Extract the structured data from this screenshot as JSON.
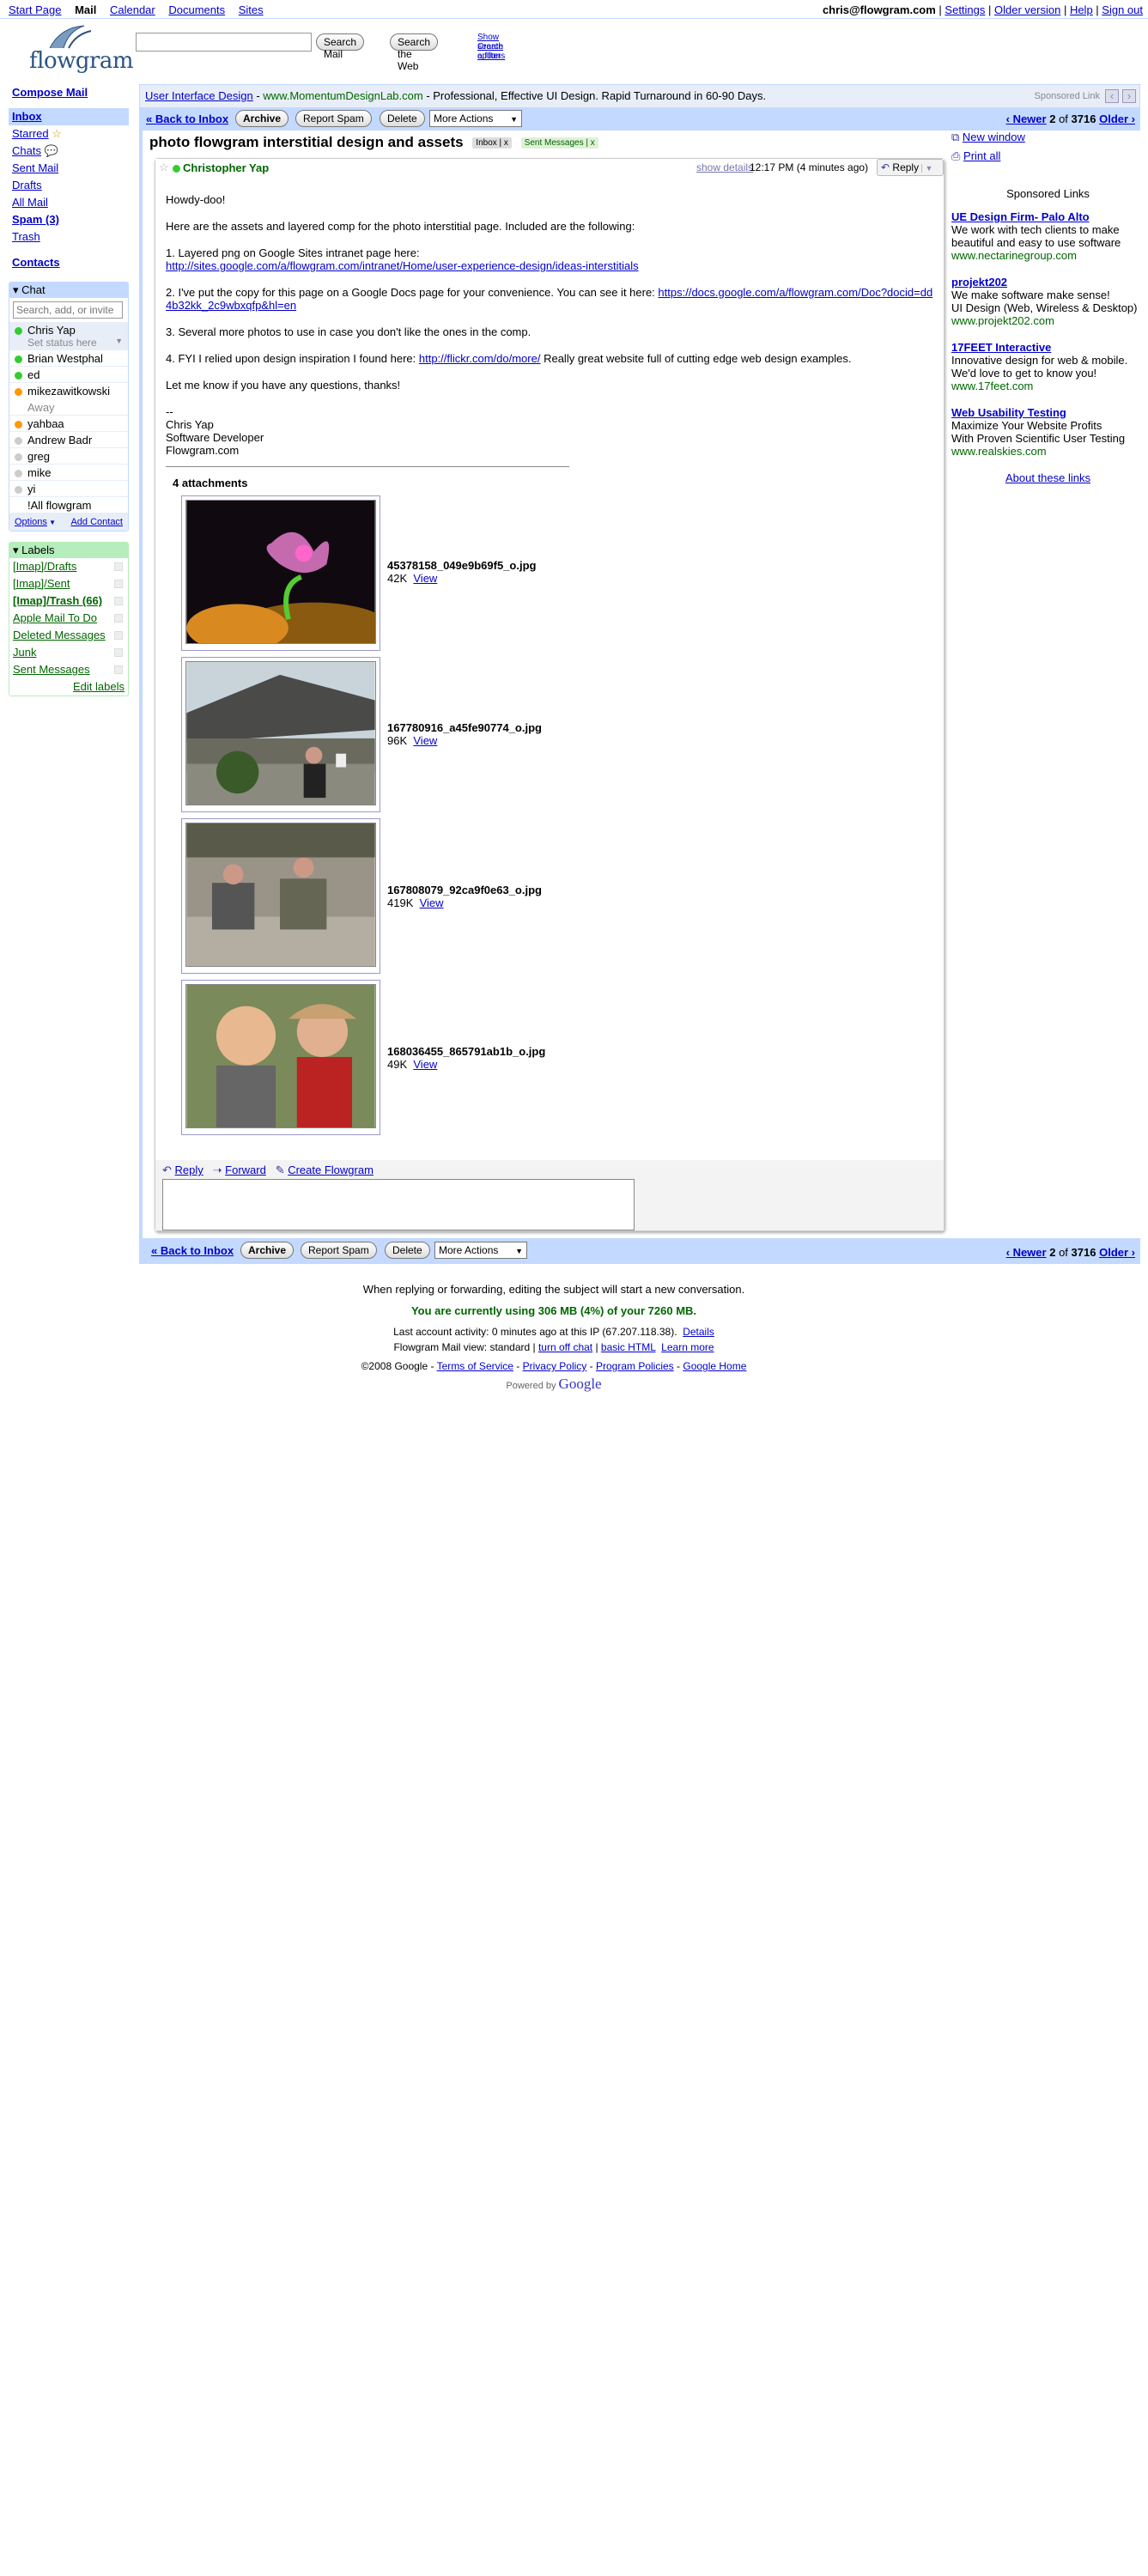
{
  "topnav": {
    "links": [
      "Start Page",
      "Mail",
      "Calendar",
      "Documents",
      "Sites"
    ],
    "user": "chris@flowgram.com",
    "right_links": [
      "Settings",
      "Older version",
      "Help",
      "Sign out"
    ]
  },
  "logo": {
    "text": "flowgram"
  },
  "search": {
    "search_mail": "Search Mail",
    "search_web": "Search the Web",
    "show_options": "Show search options",
    "create_filter": "Create a filter"
  },
  "nav": {
    "compose": "Compose Mail",
    "items": [
      "Inbox",
      "Starred",
      "Chats",
      "Sent Mail",
      "Drafts",
      "All Mail",
      "Spam (3)",
      "Trash"
    ],
    "contacts": "Contacts"
  },
  "chat": {
    "title": "Chat",
    "search_placeholder": "Search, add, or invite",
    "me": "Chris Yap",
    "set_status": "Set status here",
    "contacts": [
      {
        "name": "Brian Westphal",
        "status": "#3c3"
      },
      {
        "name": "ed",
        "status": "#3c3"
      },
      {
        "name": "mikezawitkowski",
        "status": "#f90",
        "sub": "Away"
      },
      {
        "name": "yahbaa",
        "status": "#f90"
      },
      {
        "name": "Andrew Badr",
        "status": "#ccc"
      },
      {
        "name": "greg",
        "status": "#ccc"
      },
      {
        "name": "mike",
        "status": "#ccc"
      },
      {
        "name": "yi",
        "status": "#ccc"
      },
      {
        "name": "!All flowgram",
        "status": ""
      }
    ],
    "options": "Options",
    "add_contact": "Add Contact"
  },
  "labels": {
    "title": "Labels",
    "items": [
      "[Imap]/Drafts",
      "[Imap]/Sent",
      "[Imap]/Trash (66)",
      "Apple Mail To Do",
      "Deleted Messages",
      "Junk",
      "Sent Messages"
    ],
    "edit": "Edit labels"
  },
  "ad": {
    "link": "User Interface Design",
    "url": "www.MomentumDesignLab.com",
    "text": " - Professional, Effective UI Design. Rapid Turnaround in 60-90 Days.",
    "sponsored": "Sponsored Link"
  },
  "toolbar": {
    "back": "« Back to Inbox",
    "archive": "Archive",
    "report_spam": "Report Spam",
    "delete": "Delete",
    "more_actions": "More Actions",
    "newer": "‹ Newer",
    "pos": "2",
    "of": "of",
    "total": "3716",
    "older": "Older ›"
  },
  "message": {
    "subject": "photo flowgram interstitial design and assets",
    "tags": [
      "Inbox",
      "Sent Messages"
    ],
    "sender": "Christopher Yap",
    "show_details": "show details",
    "time": "12:17 PM (4 minutes ago)",
    "reply": "Reply",
    "body": {
      "greeting": "Howdy-doo!",
      "intro": "Here are the assets and layered comp for the photo interstitial page.  Included are the following:",
      "p1": "1. Layered png on Google Sites intranet page here:",
      "p1_link": "http://sites.google.com/a/flowgram.com/intranet/Home/user-experience-design/ideas-interstitials",
      "p2": "2. I've put the copy for this page on a Google Docs page for your convenience.  You can see it here: ",
      "p2_link": "https://docs.google.com/a/flowgram.com/Doc?docid=dd4b32kk_2c9wbxqfp&hl=en",
      "p3": "3. Several more photos to use in case you don't like the ones in the comp.",
      "p4": "4. FYI I relied upon design inspiration I found here: ",
      "p4_link": "http://flickr.com/do/more/",
      "p4_tail": "   Really great website full of cutting edge web design examples.",
      "closing": "Let me know if you have any questions, thanks!",
      "sig": [
        "--",
        "Chris Yap",
        "Software Developer",
        "Flowgram.com"
      ]
    },
    "attach_count": "4 attachments",
    "attachments": [
      {
        "name": "45378158_049e9b69f5_o.jpg",
        "size": "42K",
        "view": "View"
      },
      {
        "name": "167780916_a45fe90774_o.jpg",
        "size": "96K",
        "view": "View"
      },
      {
        "name": "167808079_92ca9f0e63_o.jpg",
        "size": "419K",
        "view": "View"
      },
      {
        "name": "168036455_865791ab1b_o.jpg",
        "size": "49K",
        "view": "View"
      }
    ],
    "actions": [
      "Reply",
      "Forward",
      "Create Flowgram"
    ]
  },
  "right": {
    "new_window": "New window",
    "print_all": "Print all",
    "sponsored_title": "Sponsored Links",
    "ads": [
      {
        "title": "UE Design Firm- Palo Alto",
        "lines": [
          "We work with tech clients to make",
          "beautiful and easy to use software"
        ],
        "url": "www.nectarinegroup.com"
      },
      {
        "title": "projekt202",
        "lines": [
          "We make software make sense!",
          "UI Design (Web, Wireless & Desktop)"
        ],
        "url": "www.projekt202.com"
      },
      {
        "title": "17FEET Interactive",
        "lines": [
          "Innovative design for web & mobile.",
          "We'd love to get to know you!"
        ],
        "url": "www.17feet.com"
      },
      {
        "title": "Web Usability Testing",
        "lines": [
          "Maximize Your Website Profits",
          "With Proven Scientific User Testing"
        ],
        "url": "www.realskies.com"
      }
    ],
    "about": "About these links"
  },
  "footer": {
    "note": "When replying or forwarding, editing the subject will start a new conversation.",
    "usage": "You are currently using 306 MB (4%) of your 7260 MB.",
    "activity": "Last account activity: 0 minutes ago at this IP (67.207.118.38).",
    "details": "Details",
    "view": "Flowgram Mail view: standard | ",
    "turn_off_chat": "turn off chat",
    "basic_html": "basic HTML",
    "learn_more": "Learn more",
    "copyright": "©2008 Google - ",
    "links": [
      "Terms of Service",
      "Privacy Policy",
      "Program Policies",
      "Google Home"
    ],
    "powered": "Powered by",
    "google": "Google"
  }
}
